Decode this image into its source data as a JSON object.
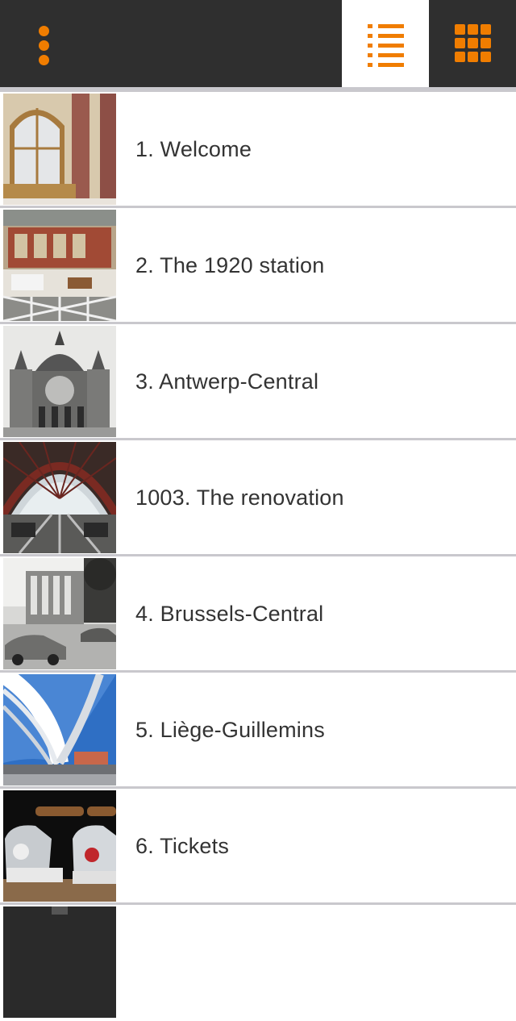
{
  "toolbar": {
    "menu_icon": "vertical-dots-icon",
    "list_view_icon": "list-view-icon",
    "grid_view_icon": "grid-view-icon",
    "accent_color": "#f07d00",
    "bar_color": "#2f2f2f",
    "active_view": "list"
  },
  "items": [
    {
      "title": "1. Welcome",
      "thumb": "station-hall-interior"
    },
    {
      "title": "2. The 1920 station",
      "thumb": "station-ticket-hall"
    },
    {
      "title": "3. Antwerp-Central",
      "thumb": "antwerp-central-postcard"
    },
    {
      "title": "1003. The renovation",
      "thumb": "platform-roof-renovation"
    },
    {
      "title": "4. Brussels-Central",
      "thumb": "brussels-central-vintage"
    },
    {
      "title": "5. Liège-Guillemins",
      "thumb": "liege-guillemins-roof"
    },
    {
      "title": "6. Tickets",
      "thumb": "ticket-machines"
    },
    {
      "title": "",
      "thumb": "next-item"
    }
  ]
}
